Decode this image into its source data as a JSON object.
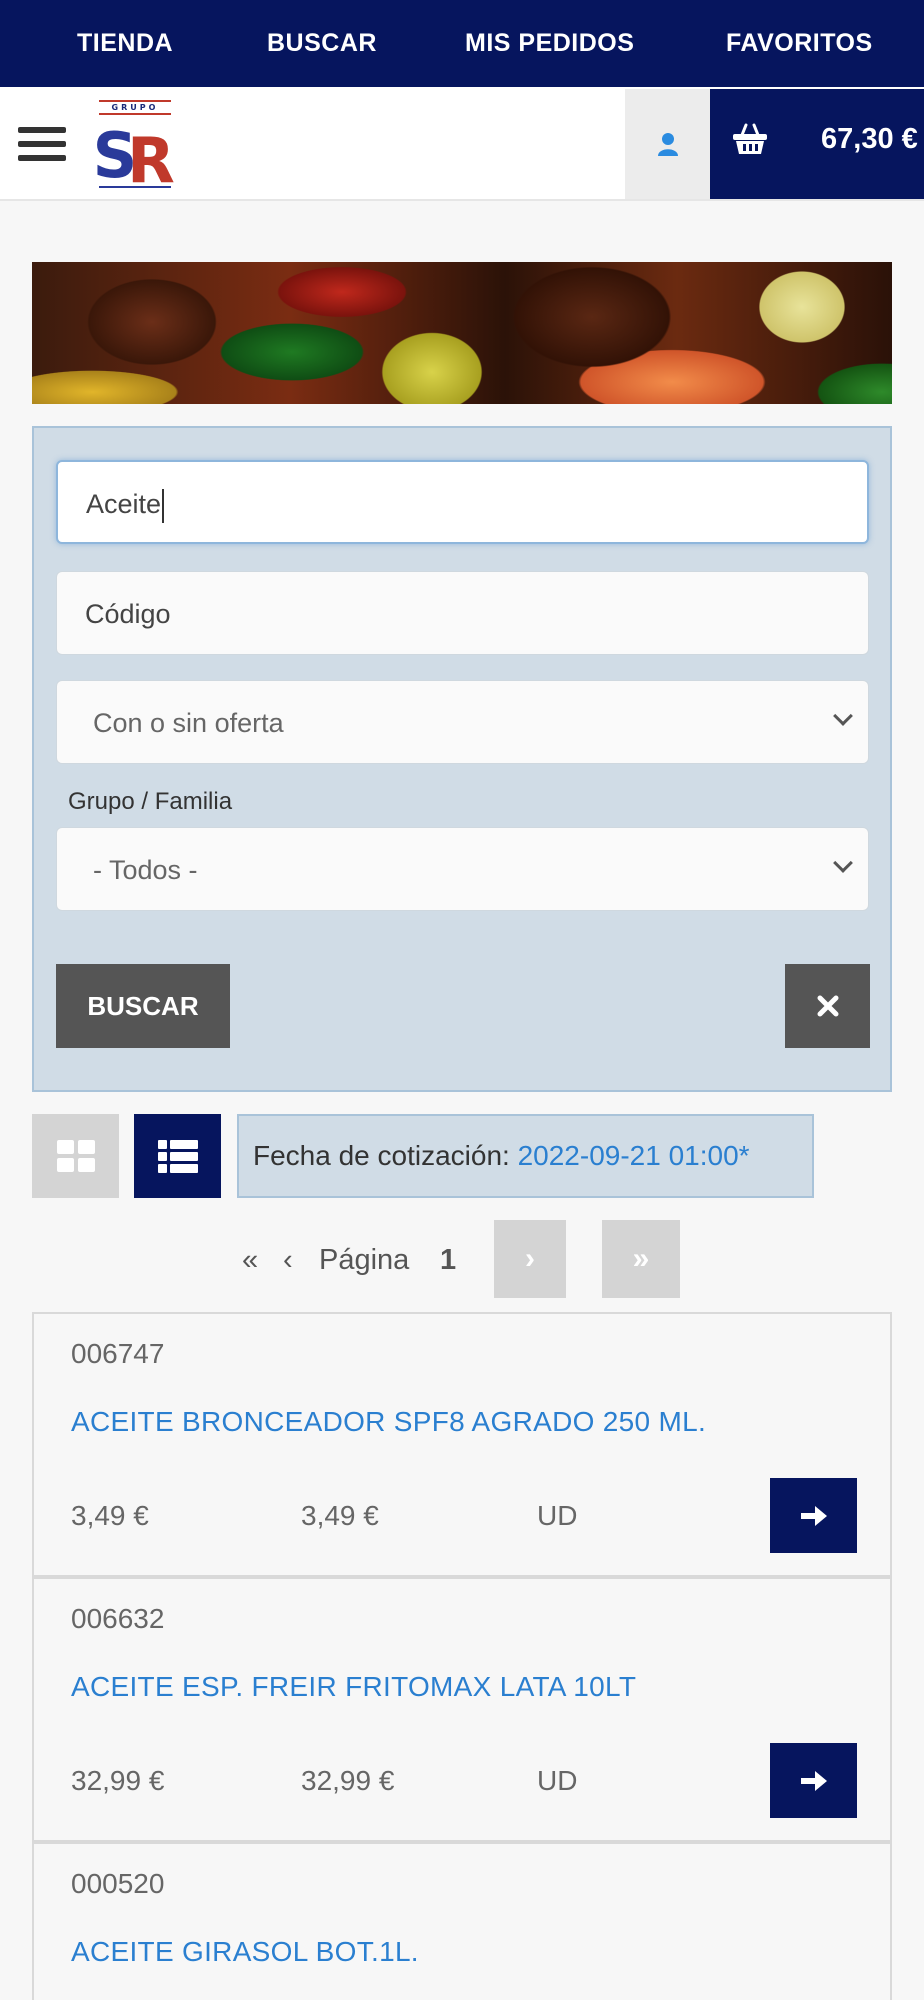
{
  "topnav": {
    "items": [
      {
        "label": "TIENDA"
      },
      {
        "label": "BUSCAR"
      },
      {
        "label": "MIS PEDIDOS"
      },
      {
        "label": "FAVORITOS"
      }
    ]
  },
  "header": {
    "logo_top": "GRUPO",
    "logo_text": "SR",
    "cart_total": "67,30 €"
  },
  "search": {
    "description_value": "Aceite",
    "code_placeholder": "Código",
    "offer_select": "Con o sin oferta",
    "group_label": "Grupo / Familia",
    "group_select": "- Todos -",
    "submit_label": "BUSCAR"
  },
  "quote": {
    "label": "Fecha de cotización:",
    "date": "2022-09-21 01:00*"
  },
  "pagination": {
    "first": "«",
    "prev": "‹",
    "label": "Página",
    "current": "1",
    "next": "›",
    "last": "»"
  },
  "products": [
    {
      "code": "006747",
      "name": "ACEITE BRONCEADOR SPF8 AGRADO 250 ML.",
      "price1": "3,49 €",
      "price2": "3,49 €",
      "unit": "UD"
    },
    {
      "code": "006632",
      "name": "ACEITE ESP. FREIR FRITOMAX LATA 10LT",
      "price1": "32,99 €",
      "price2": "32,99 €",
      "unit": "UD"
    },
    {
      "code": "000520",
      "name": "ACEITE GIRASOL BOT.1L."
    }
  ],
  "colors": {
    "brand": "#06155e",
    "link": "#2a7fd0",
    "panel": "#d0dce6",
    "button_gray": "#555555"
  }
}
